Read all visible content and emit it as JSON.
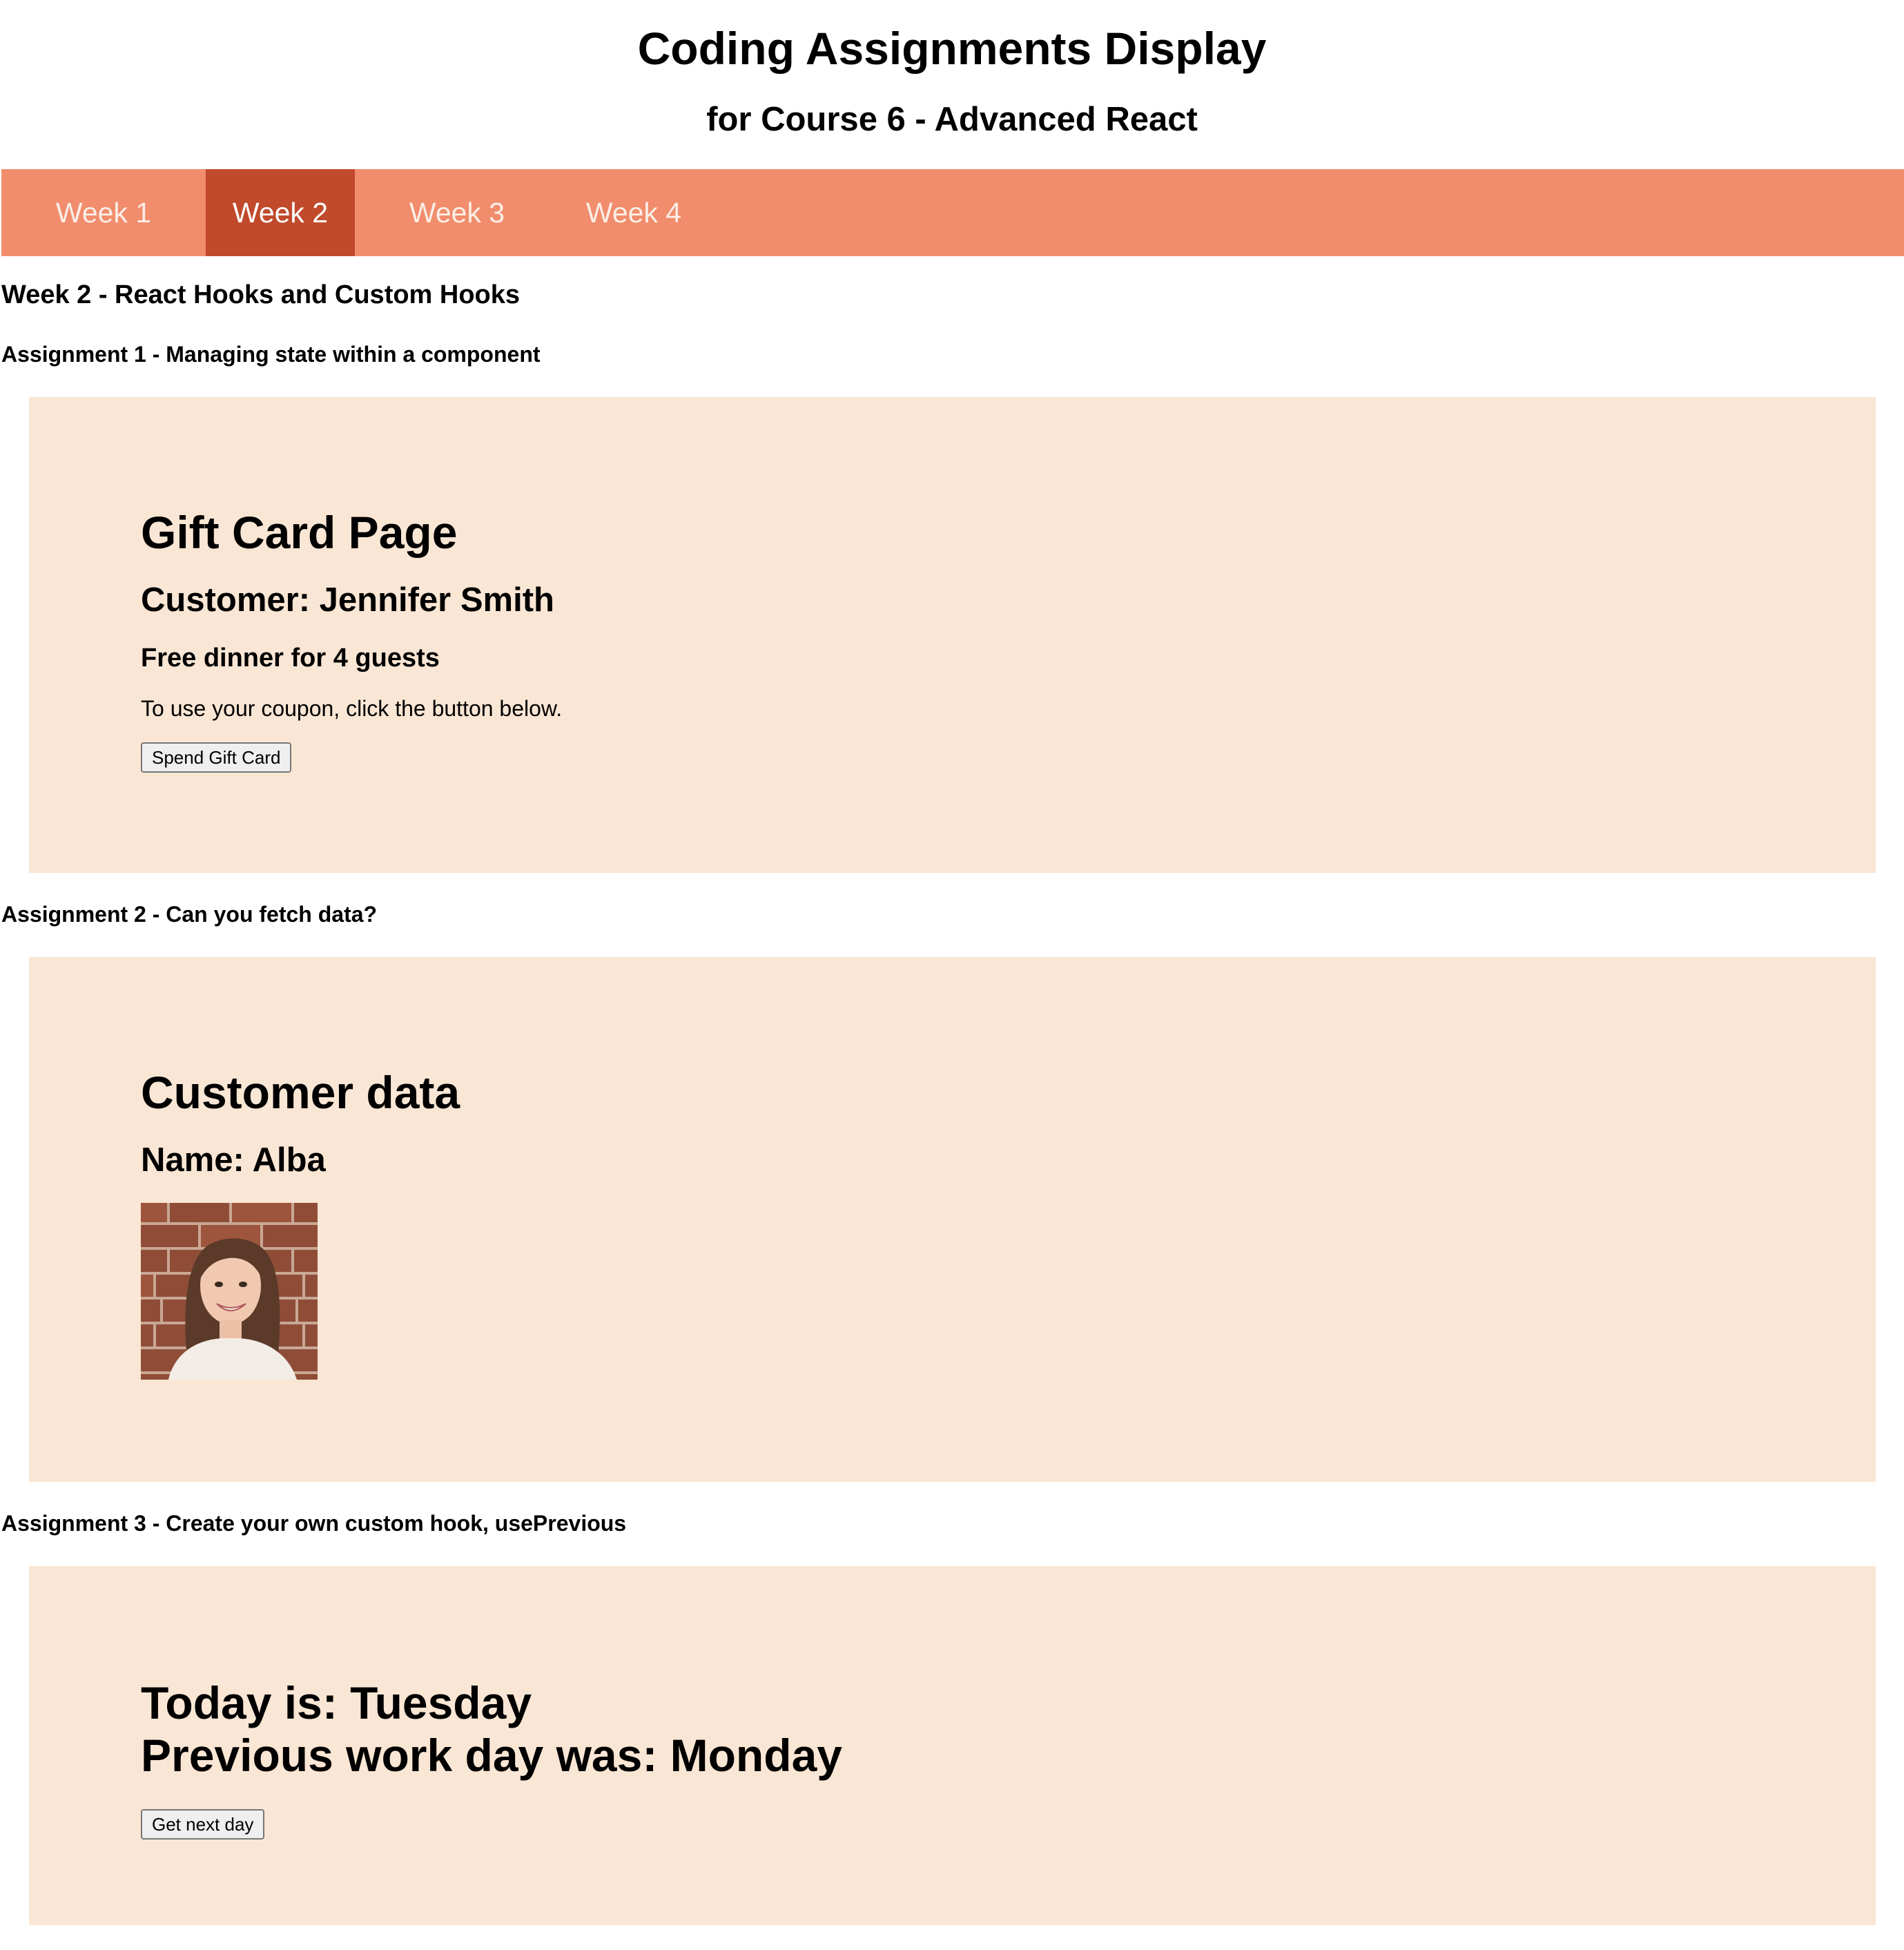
{
  "header": {
    "title": "Coding Assignments Display",
    "subtitle": "for Course 6 - Advanced React"
  },
  "nav": {
    "tabs": [
      {
        "label": "Week 1",
        "active": false
      },
      {
        "label": "Week 2",
        "active": true
      },
      {
        "label": "Week 3",
        "active": false
      },
      {
        "label": "Week 4",
        "active": false
      }
    ]
  },
  "week": {
    "heading": "Week 2 - React Hooks and Custom Hooks"
  },
  "assignments": [
    {
      "heading": "Assignment 1 - Managing state within a component",
      "panel": {
        "title": "Gift Card Page",
        "customer": "Customer: Jennifer Smith",
        "offer": "Free dinner for 4 guests",
        "instructions": "To use your coupon, click the button below.",
        "button_label": "Spend Gift Card"
      }
    },
    {
      "heading": "Assignment 2 - Can you fetch data?",
      "panel": {
        "title": "Customer data",
        "name": "Name: Alba",
        "avatar_icon": "customer-photo"
      }
    },
    {
      "heading": "Assignment 3 - Create your own custom hook, usePrevious",
      "panel": {
        "today": "Today is: Tuesday",
        "previous": "Previous work day was: Monday",
        "button_label": "Get next day"
      }
    }
  ],
  "colors": {
    "nav_bg": "#f18d6c",
    "nav_active": "#c04a2b",
    "panel_bg": "#fae6d4"
  }
}
